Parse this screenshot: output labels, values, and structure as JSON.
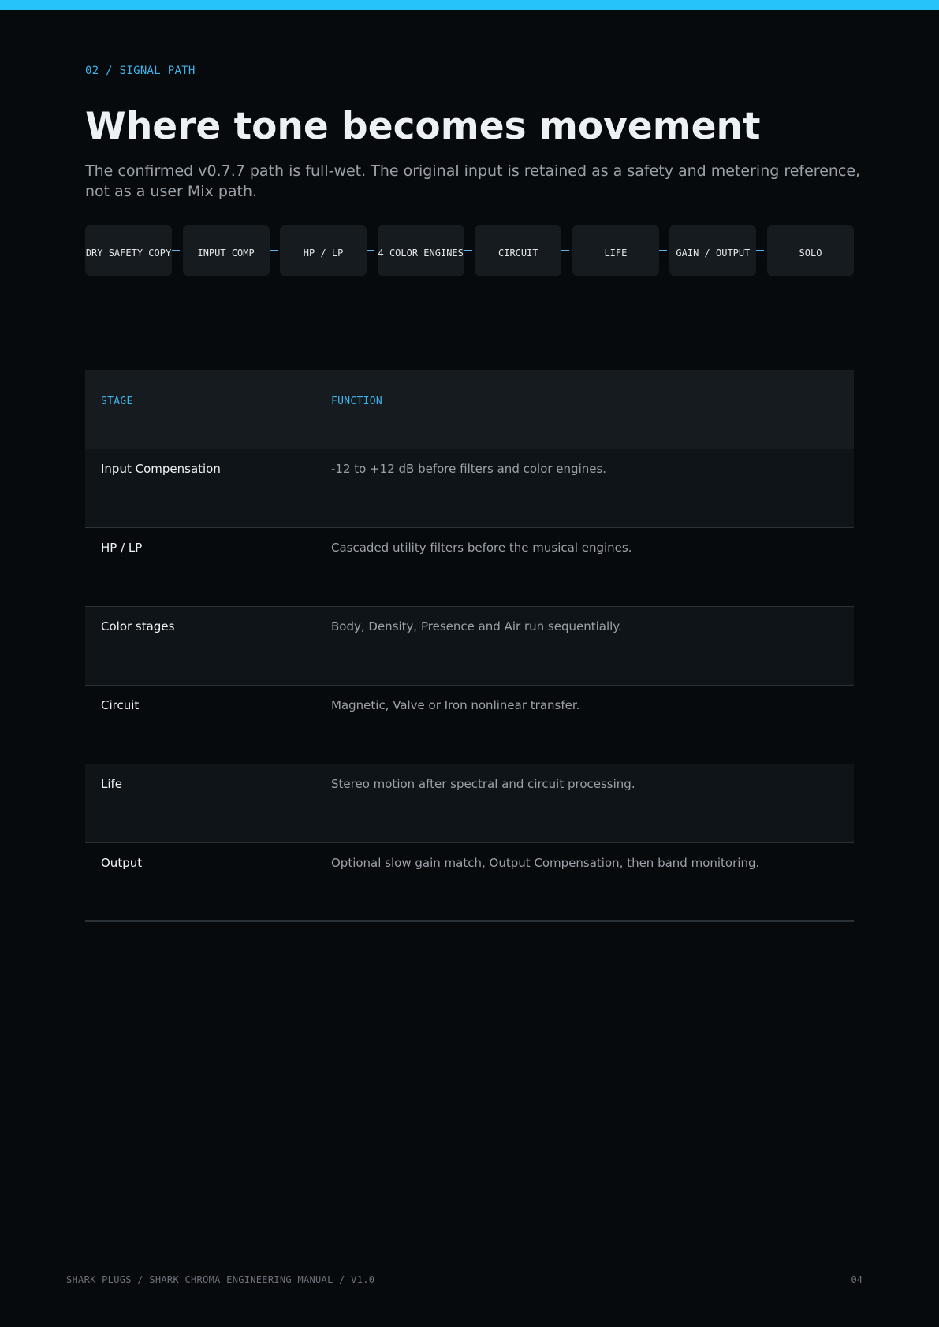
{
  "colors": {
    "accent": "#26c3fb",
    "label": "#3fb4ec",
    "background": "#070a0d",
    "panel": "#151b1f"
  },
  "header": {
    "eyebrow": "02 / SIGNAL PATH",
    "title": "Where tone becomes movement",
    "subtitle": "The confirmed v0.7.7 path is full-wet. The original input is retained as a safety and metering reference, not as a user Mix path."
  },
  "signal_chain": [
    "DRY SAFETY COPY",
    "INPUT COMP",
    "HP / LP",
    "4 COLOR ENGINES",
    "CIRCUIT",
    "LIFE",
    "GAIN / OUTPUT",
    "SOLO"
  ],
  "table": {
    "headers": [
      "STAGE",
      "FUNCTION"
    ],
    "rows": [
      [
        "Input Compensation",
        "-12 to +12 dB before filters and color engines."
      ],
      [
        "HP / LP",
        "Cascaded utility filters before the musical engines."
      ],
      [
        "Color stages",
        "Body, Density, Presence and Air run sequentially."
      ],
      [
        "Circuit",
        "Magnetic, Valve or Iron nonlinear transfer."
      ],
      [
        "Life",
        "Stereo motion after spectral and circuit processing."
      ],
      [
        "Output",
        "Optional slow gain match, Output Compensation, then band monitoring."
      ]
    ]
  },
  "footer": {
    "left": "SHARK PLUGS / SHARK CHROMA ENGINEERING MANUAL / V1.0",
    "page_number": "04"
  }
}
